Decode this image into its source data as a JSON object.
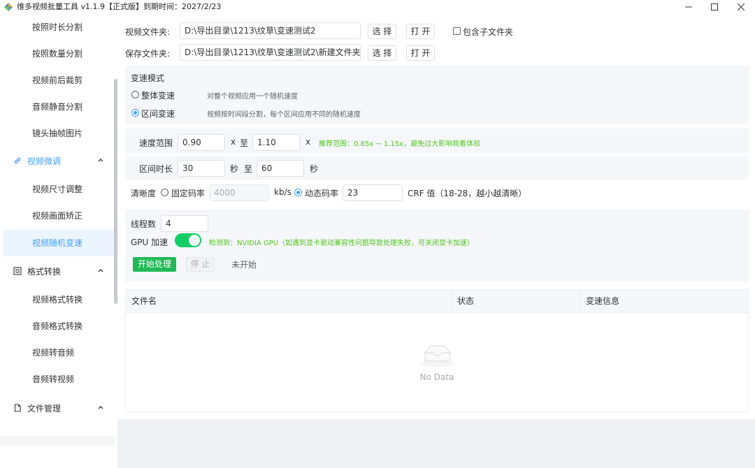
{
  "window": {
    "title": "维多视频批量工具 v1.1.9【正式版】到期时间：2027/2/23",
    "brand_colors": [
      "#f5a623",
      "#4a90e2",
      "#7ed321"
    ]
  },
  "sidebar": {
    "items_top": [
      {
        "label": "按照时长分割"
      },
      {
        "label": "按照数量分割"
      },
      {
        "label": "视频前后裁剪"
      },
      {
        "label": "音频静音分割"
      },
      {
        "label": "镜头抽帧图片"
      }
    ],
    "group_video_tweak": {
      "label": "视频微调",
      "icon": "link-icon",
      "expanded": true
    },
    "items_tweak": [
      {
        "label": "视频尺寸调整"
      },
      {
        "label": "视频画面矫正"
      },
      {
        "label": "视频随机变速",
        "active": true
      }
    ],
    "group_format": {
      "label": "格式转换",
      "icon": "square-frame-icon",
      "expanded": true
    },
    "items_format": [
      {
        "label": "视频格式转换"
      },
      {
        "label": "音频格式转换"
      },
      {
        "label": "视频转音频"
      },
      {
        "label": "音频转视频"
      }
    ],
    "group_files": {
      "label": "文件管理",
      "icon": "document-icon",
      "expanded": true
    }
  },
  "folders": {
    "video_label": "视频文件夹:",
    "video_path": "D:\\导出目录\\1213\\纹草\\变速测试2",
    "save_label": "保存文件夹:",
    "save_path": "D:\\导出目录\\1213\\纹草\\变速测试2\\新建文件夹",
    "select_label": "选 择",
    "open_label": "打 开",
    "include_sub_label": "包含子文件夹",
    "include_sub_checked": false
  },
  "mode": {
    "title": "变速模式",
    "option_whole": "整体变速",
    "option_whole_desc": "对整个视频应用一个随机速度",
    "option_segment": "区间变速",
    "option_segment_desc": "视频按时间段分割，每个区间应用不同的随机速度",
    "selected": "区间变速"
  },
  "speed": {
    "label": "速度范围",
    "min": "0.90",
    "x1": "x",
    "to": "至",
    "max": "1.10",
    "x2": "x",
    "hint": "推荐范围：0.85x ~ 1.15x，避免过大影响观看体验"
  },
  "interval": {
    "label": "区间时长",
    "min": "30",
    "unit1": "秒",
    "to": "至",
    "max": "60",
    "unit2": "秒"
  },
  "quality": {
    "label": "清晰度",
    "fixed_label": "固定码率",
    "fixed_placeholder": "4000",
    "kbps": "kb/s",
    "dynamic_label": "动态码率",
    "crf_value": "23",
    "crf_hint": "CRF 值（18-28，越小越清晰）",
    "selected": "动态码率"
  },
  "threads": {
    "label": "线程数",
    "value": "4"
  },
  "gpu": {
    "label": "GPU 加速",
    "enabled": true,
    "hint": "检测到：NVIDIA GPU（如遇到显卡驱动兼容性问题导致处理失败，可关闭显卡加速）"
  },
  "actions": {
    "start": "开始处理",
    "stop": "停 止",
    "status": "未开始"
  },
  "table": {
    "columns": [
      "文件名",
      "状态",
      "变速信息"
    ],
    "empty_text": "No Data"
  }
}
